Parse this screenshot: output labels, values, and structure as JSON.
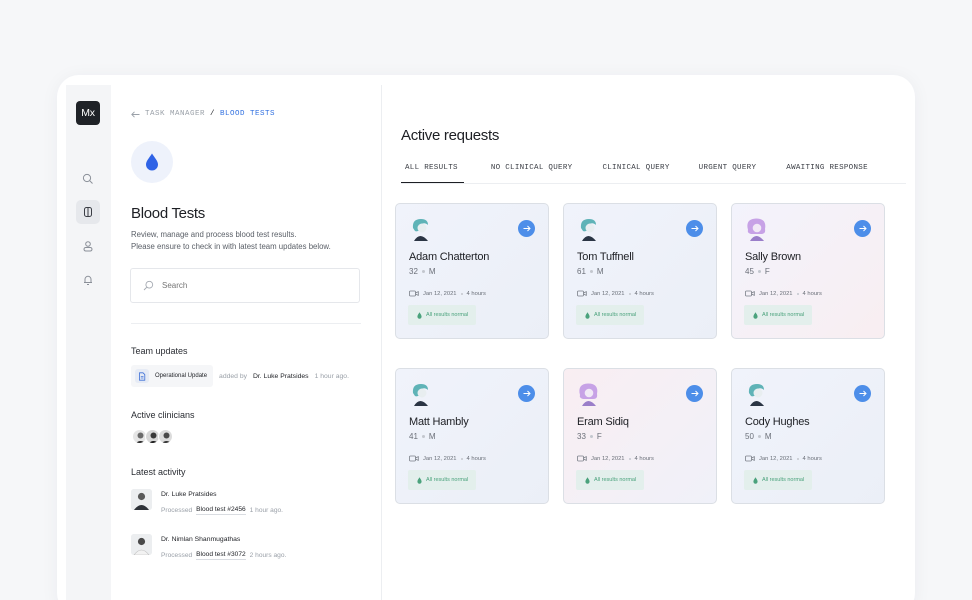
{
  "app": {
    "logo_text": "Mx",
    "rail_icons": [
      "search-icon",
      "tests-icon",
      "user-icon",
      "bell-icon"
    ]
  },
  "breadcrumb": {
    "parent": "TASK MANAGER",
    "separator": "/",
    "current": "BLOOD TESTS"
  },
  "page": {
    "title": "Blood Tests",
    "description_line1": "Review, manage and process blood test results.",
    "description_line2": "Please ensure to check in with latest team updates below.",
    "search_placeholder": "Search"
  },
  "team_updates": {
    "heading": "Team updates",
    "item_label": "Operational Update",
    "added_by_text": "added by",
    "author": "Dr. Luke Pratsides",
    "time": "1 hour ago."
  },
  "active_clinicians": {
    "heading": "Active clinicians",
    "count": 3
  },
  "latest_activity": {
    "heading": "Latest activity",
    "items": [
      {
        "name": "Dr. Luke Pratsides",
        "action": "Processed",
        "test": "Blood test #2456",
        "time": "1 hour ago."
      },
      {
        "name": "Dr. Nimlan Shanmugathas",
        "action": "Processed",
        "test": "Blood test #3072",
        "time": "2 hours ago."
      }
    ]
  },
  "requests": {
    "title": "Active requests",
    "tabs": [
      "ALL RESULTS",
      "NO CLINICAL QUERY",
      "CLINICAL QUERY",
      "URGENT QUERY",
      "AWAITING RESPONSE"
    ],
    "active_tab": 0,
    "cards": [
      {
        "name": "Adam Chatterton",
        "age": "32",
        "sex": "M",
        "date": "Jan 12, 2021",
        "duration": "4 hours",
        "status": "All results normal"
      },
      {
        "name": "Tom Tuffnell",
        "age": "61",
        "sex": "M",
        "date": "Jan 12, 2021",
        "duration": "4 hours",
        "status": "All results normal"
      },
      {
        "name": "Sally Brown",
        "age": "45",
        "sex": "F",
        "date": "Jan 12, 2021",
        "duration": "4 hours",
        "status": "All results normal"
      },
      {
        "name": "Matt Hambly",
        "age": "41",
        "sex": "M",
        "date": "Jan 12, 2021",
        "duration": "4 hours",
        "status": "All results normal"
      },
      {
        "name": "Eram Sidiq",
        "age": "33",
        "sex": "F",
        "date": "Jan 12, 2021",
        "duration": "4 hours",
        "status": "All results normal"
      },
      {
        "name": "Cody Hughes",
        "age": "50",
        "sex": "M",
        "date": "Jan 12, 2021",
        "duration": "4 hours",
        "status": "All results normal"
      }
    ]
  },
  "colors": {
    "accent_blue": "#4d8ee9",
    "breadcrumb_active": "#2f6fe0",
    "status_green": "#4aa27c",
    "male_avatar": "#5fb3b7",
    "female_avatar": "#c7a2e6"
  }
}
